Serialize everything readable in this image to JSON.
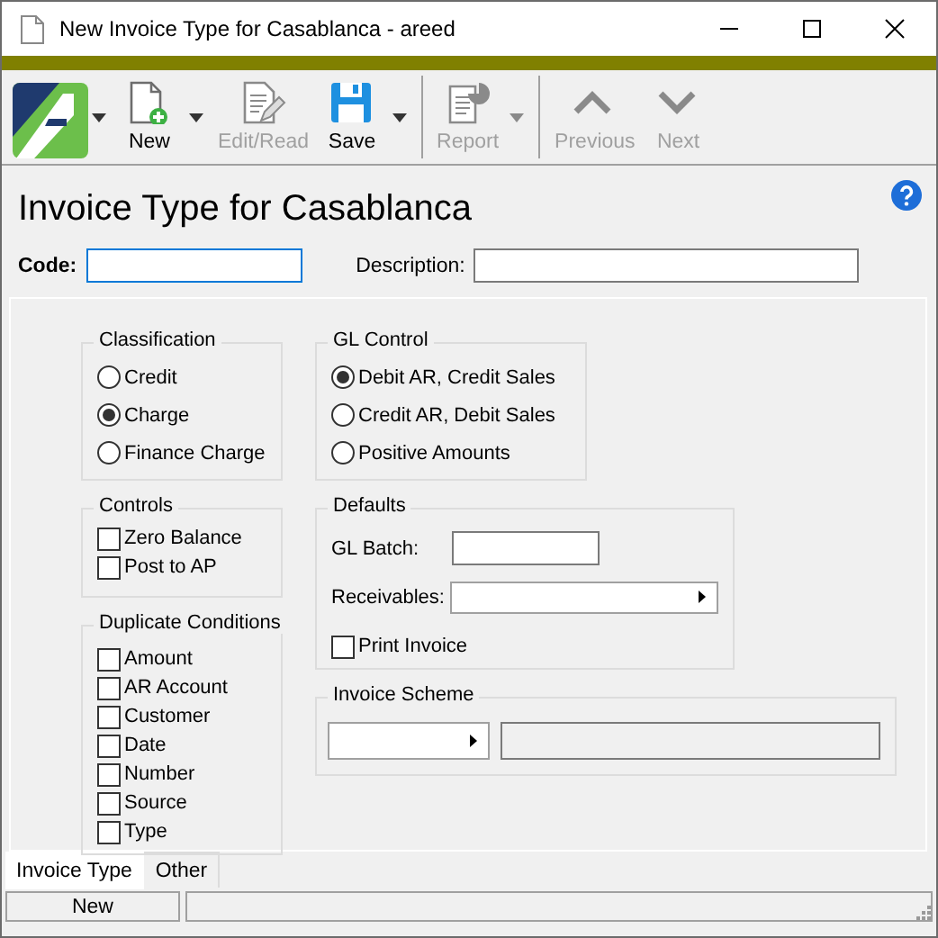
{
  "window": {
    "title": "New Invoice Type for Casablanca - areed"
  },
  "toolbar": [
    {
      "kind": "logo",
      "has_menu": true
    },
    {
      "kind": "new",
      "label": "New",
      "disabled": false,
      "has_menu": true
    },
    {
      "kind": "edit",
      "label": "Edit/Read",
      "disabled": true,
      "has_menu": false
    },
    {
      "kind": "save",
      "label": "Save",
      "disabled": false,
      "has_menu": true
    },
    {
      "kind": "separator"
    },
    {
      "kind": "report",
      "label": "Report",
      "disabled": true,
      "has_menu": true
    },
    {
      "kind": "separator"
    },
    {
      "kind": "previous",
      "label": "Previous",
      "disabled": true,
      "has_menu": false
    },
    {
      "kind": "next",
      "label": "Next",
      "disabled": true,
      "has_menu": false
    }
  ],
  "heading": "Invoice Type for Casablanca",
  "code": {
    "label": "Code:"
  },
  "description": {
    "label": "Description:"
  },
  "classification": {
    "title": "Classification",
    "options": [
      {
        "label": "Credit",
        "selected": false
      },
      {
        "label": "Charge",
        "selected": true
      },
      {
        "label": "Finance Charge",
        "selected": false
      }
    ]
  },
  "gl_control": {
    "title": "GL Control",
    "options": [
      {
        "label": "Debit AR, Credit Sales",
        "selected": true
      },
      {
        "label": "Credit AR, Debit Sales",
        "selected": false
      },
      {
        "label": "Positive Amounts",
        "selected": false
      }
    ]
  },
  "controls": {
    "title": "Controls",
    "items": [
      {
        "label": "Zero Balance",
        "checked": false
      },
      {
        "label": "Post to AP",
        "checked": false
      }
    ]
  },
  "defaults": {
    "title": "Defaults",
    "gl_batch_label": "GL Batch:",
    "receivables_label": "Receivables:",
    "print_invoice": {
      "label": "Print Invoice",
      "checked": false
    }
  },
  "duplicate_conditions": {
    "title": "Duplicate Conditions",
    "items": [
      {
        "label": "Amount",
        "checked": false
      },
      {
        "label": "AR Account",
        "checked": false
      },
      {
        "label": "Customer",
        "checked": false
      },
      {
        "label": "Date",
        "checked": false
      },
      {
        "label": "Number",
        "checked": false
      },
      {
        "label": "Source",
        "checked": false
      },
      {
        "label": "Type",
        "checked": false
      }
    ]
  },
  "invoice_scheme": {
    "title": "Invoice Scheme"
  },
  "tabs": [
    {
      "label": "Invoice Type",
      "selected": true
    },
    {
      "label": "Other",
      "selected": false
    }
  ],
  "status_bar": {
    "mode": "New"
  }
}
